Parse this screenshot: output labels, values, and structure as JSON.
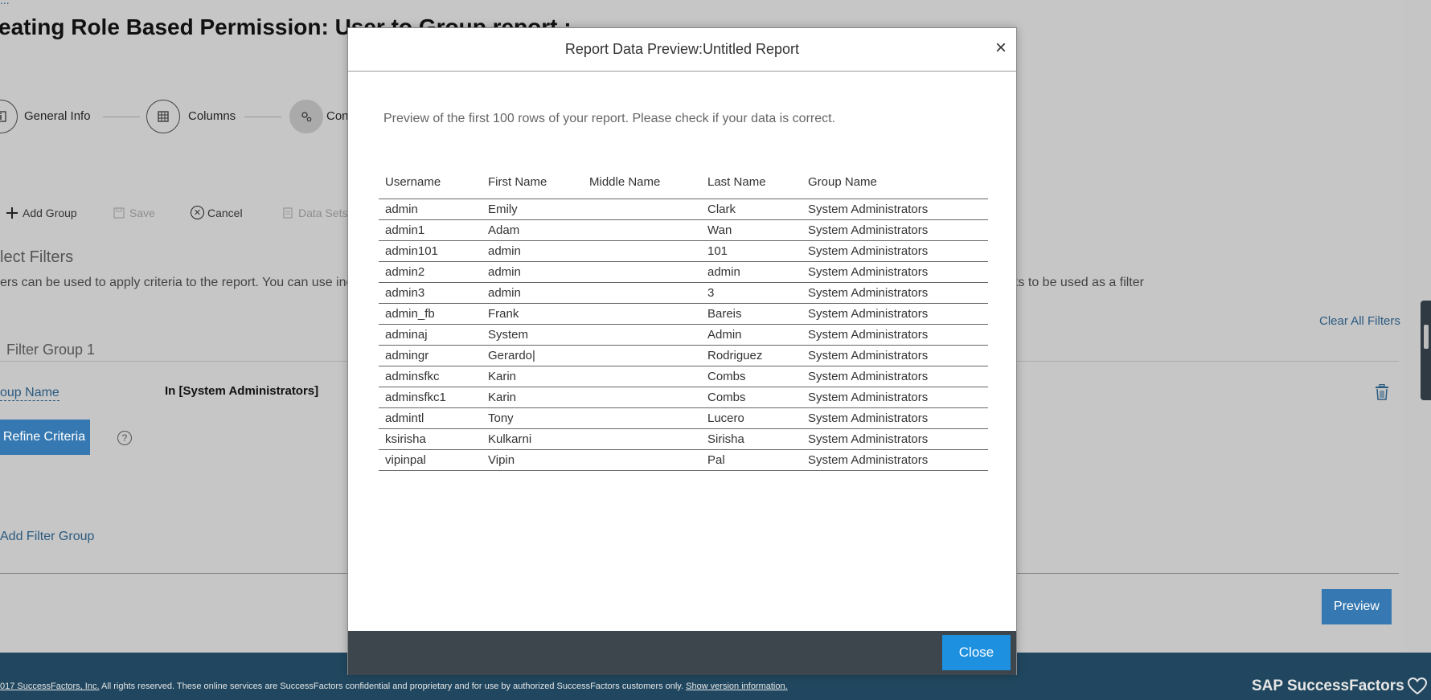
{
  "background": {
    "top_link": "...",
    "title": "eating Role Based Permission: User to Group report :",
    "steps": [
      {
        "label": "General Info",
        "icon": "info-icon"
      },
      {
        "label": "Columns",
        "icon": "grid-icon"
      },
      {
        "label": "Con",
        "icon": "gears-icon"
      }
    ],
    "toolbar": {
      "add_group": "Add Group",
      "save": "Save",
      "cancel": "Cancel",
      "data_sets": "Data Sets"
    },
    "section_title": "lect Filters",
    "section_desc_left": "ers can be used to apply criteria to the report. You can use ind",
    "section_desc_right": "ts to be used as a filter",
    "clear_filters": "Clear All Filters",
    "filter_group_title": "Filter Group 1",
    "filter_field": "oup Name",
    "filter_value": "In [System Administrators]",
    "refine_criteria": "Refine Criteria",
    "help": "?",
    "add_filter_group": "Add Filter Group",
    "preview": "Preview"
  },
  "footer": {
    "copyright_link": "017 SuccessFactors, Inc.",
    "copyright_text": " All rights reserved. These online services are SuccessFactors confidential and proprietary and for use by authorized SuccessFactors customers only. ",
    "version_link": "Show version information.",
    "brand": "SAP SuccessFactors"
  },
  "modal": {
    "title": "Report Data Preview:Untitled Report",
    "close_x": "×",
    "description": "Preview of the first 100 rows of your report. Please check if your data is correct.",
    "columns": [
      "Username",
      "First Name",
      "Middle Name",
      "Last Name",
      "Group Name"
    ],
    "rows": [
      [
        "admin",
        "Emily",
        "",
        "Clark",
        "System Administrators"
      ],
      [
        "admin1",
        "Adam",
        "",
        "Wan",
        "System Administrators"
      ],
      [
        "admin101",
        "admin",
        "",
        "101",
        "System Administrators"
      ],
      [
        "admin2",
        "admin",
        "",
        "admin",
        "System Administrators"
      ],
      [
        "admin3",
        "admin",
        "",
        "3",
        "System Administrators"
      ],
      [
        "admin_fb",
        "Frank",
        "",
        "Bareis",
        "System Administrators"
      ],
      [
        "adminaj",
        "System",
        "",
        "Admin",
        "System Administrators"
      ],
      [
        "admingr",
        "Gerardo|",
        "",
        "Rodriguez",
        "System Administrators"
      ],
      [
        "adminsfkc",
        "Karin",
        "",
        "Combs",
        "System Administrators"
      ],
      [
        "adminsfkc1",
        "Karin",
        "",
        "Combs",
        "System Administrators"
      ],
      [
        "admintl",
        "Tony",
        "",
        "Lucero",
        "System Administrators"
      ],
      [
        "ksirisha",
        "Kulkarni",
        "",
        "Sirisha",
        "System Administrators"
      ],
      [
        "vipinpal",
        "Vipin",
        "",
        "Pal",
        "System Administrators"
      ]
    ],
    "close_button": "Close"
  },
  "colors": {
    "primary_button": "#3679b2",
    "modal_close_button": "#1e90e0",
    "footer_bg": "#20475f",
    "modal_footer_bg": "#3e464d",
    "link": "#2a5a80"
  }
}
